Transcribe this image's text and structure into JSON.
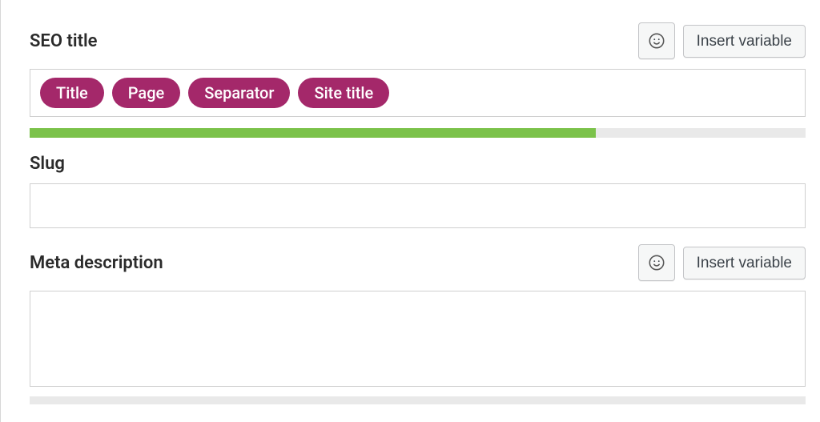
{
  "seo_title": {
    "label": "SEO title",
    "emoji_button": "emoji",
    "insert_variable_label": "Insert variable",
    "tokens": [
      "Title",
      "Page",
      "Separator",
      "Site title"
    ],
    "progress_percent": 73
  },
  "slug": {
    "label": "Slug",
    "value": ""
  },
  "meta_description": {
    "label": "Meta description",
    "emoji_button": "emoji",
    "insert_variable_label": "Insert variable",
    "value": "",
    "progress_percent": 0
  },
  "colors": {
    "token_bg": "#a4286a",
    "progress_fill": "#7bc24a"
  }
}
